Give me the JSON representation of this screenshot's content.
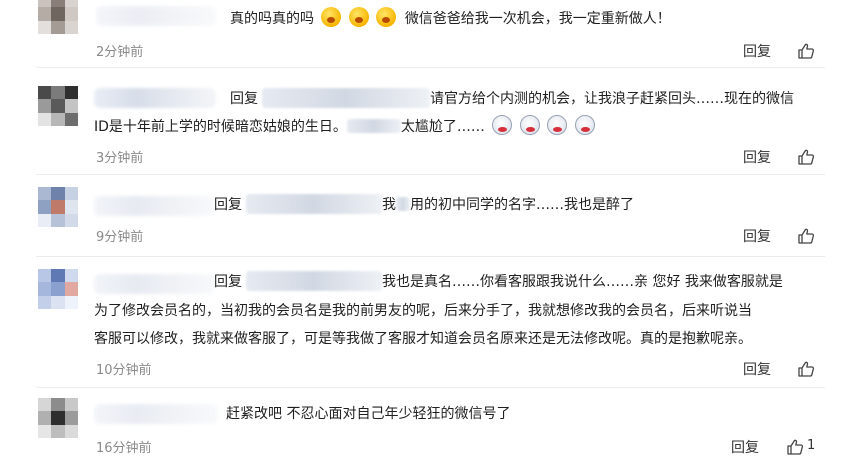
{
  "ui": {
    "reply_label": "回复",
    "reply_prefix": "回复"
  },
  "comments": [
    {
      "text": "真的吗真的吗",
      "text_after": "微信爸爸给我一次机会，我一定重新做人！",
      "emoji_count": 3,
      "emoji_kind": "astonished-face",
      "time": "2分钟前",
      "likes": ""
    },
    {
      "line1_after": "请官方给个内测的机会，让我浪子赶紧回头……现在的微信",
      "line2_before": "ID是十年前上学的时候暗恋姑娘的生日。",
      "line2_after": "太尴尬了……",
      "emoji_count": 4,
      "emoji_kind": "scared-face",
      "time": "3分钟前",
      "likes": ""
    },
    {
      "text_before": "我",
      "text_after": "用的初中同学的名字……我也是醉了",
      "time": "9分钟前",
      "likes": ""
    },
    {
      "line1": "我也是真名……你看客服跟我说什么……亲 您好 我来做客服就是",
      "line2": "为了修改会员名的，当初我的会员名是我的前男友的呢，后来分手了，我就想修改我的会员名，后来听说当",
      "line3": "客服可以修改，我就来做客服了，可是等我做了客服才知道会员名原来还是无法修改呢。真的是抱歉呢亲。",
      "time": "10分钟前",
      "likes": ""
    },
    {
      "text": "赶紧改吧 不忍心面对自己年少轻狂的微信号了",
      "time": "16分钟前",
      "likes": "1"
    }
  ]
}
